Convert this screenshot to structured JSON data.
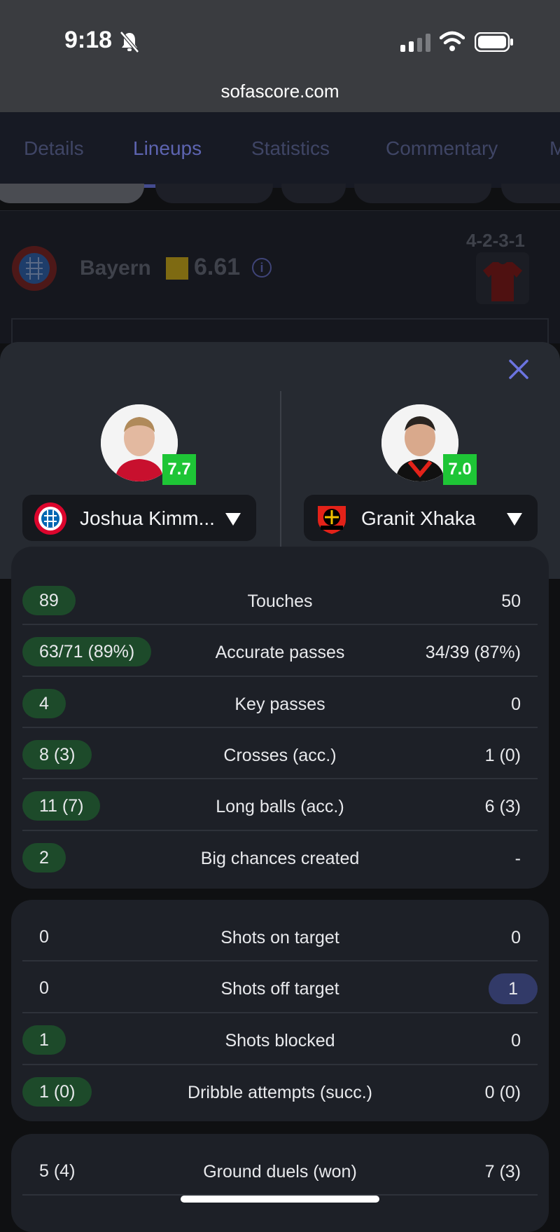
{
  "status": {
    "time": "9:18"
  },
  "browser": {
    "url": "sofascore.com"
  },
  "tabs": [
    {
      "label": "Details"
    },
    {
      "label": "Lineups"
    },
    {
      "label": "Statistics"
    },
    {
      "label": "Commentary"
    },
    {
      "label": "M"
    }
  ],
  "active_tab": "Lineups",
  "team": {
    "name": "Bayern",
    "rating": "6.61",
    "formation": "4-2-3-1"
  },
  "comparison": {
    "player_left": {
      "name": "Joshua Kimm...",
      "rating": "7.7",
      "rating_color": "#1ec536"
    },
    "player_right": {
      "name": "Granit Xhaka",
      "rating": "7.0",
      "rating_color": "#1ec536"
    }
  },
  "stats_group_1": [
    {
      "left": "89",
      "label": "Touches",
      "right": "50",
      "highlight": "left"
    },
    {
      "left": "63/71 (89%)",
      "label": "Accurate passes",
      "right": "34/39 (87%)",
      "highlight": "left"
    },
    {
      "left": "4",
      "label": "Key passes",
      "right": "0",
      "highlight": "left"
    },
    {
      "left": "8 (3)",
      "label": "Crosses (acc.)",
      "right": "1 (0)",
      "highlight": "left"
    },
    {
      "left": "11 (7)",
      "label": "Long balls (acc.)",
      "right": "6 (3)",
      "highlight": "left"
    },
    {
      "left": "2",
      "label": "Big chances created",
      "right": "-",
      "highlight": "left"
    }
  ],
  "stats_group_2": [
    {
      "left": "0",
      "label": "Shots on target",
      "right": "0",
      "highlight": "none"
    },
    {
      "left": "0",
      "label": "Shots off target",
      "right": "1",
      "highlight": "right"
    },
    {
      "left": "1",
      "label": "Shots blocked",
      "right": "0",
      "highlight": "left"
    },
    {
      "left": "1 (0)",
      "label": "Dribble attempts (succ.)",
      "right": "0 (0)",
      "highlight": "left"
    }
  ],
  "stats_group_3": [
    {
      "left": "5 (4)",
      "label": "Ground duels (won)",
      "right": "7 (3)",
      "highlight": "none"
    }
  ],
  "colors": {
    "highlight_left": "#1d4a2a",
    "highlight_right": "#323a68",
    "accent": "#6b74e0"
  }
}
